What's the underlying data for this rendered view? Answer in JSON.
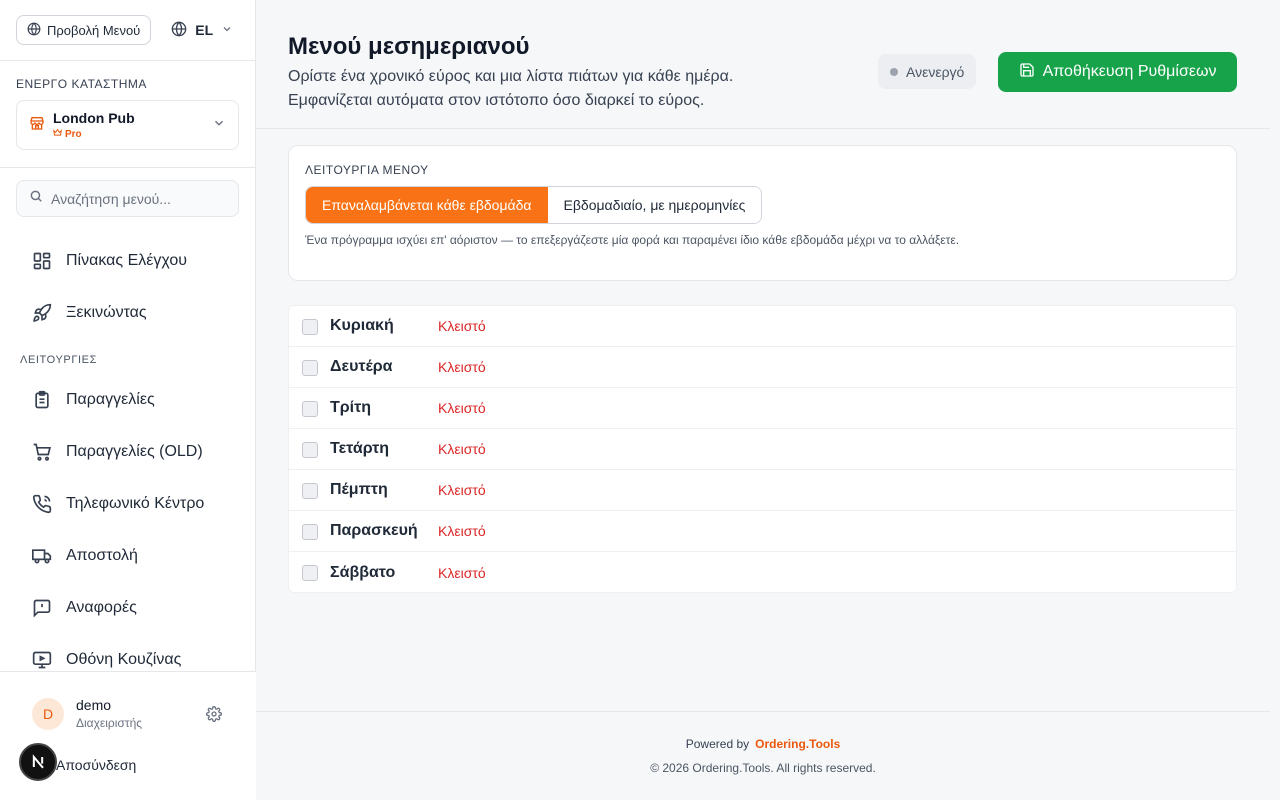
{
  "sidebar": {
    "view_menu_label": "Προβολή Μενού",
    "language_code": "EL",
    "active_store_label": "ΕΝΕΡΓΟ ΚΑΤΑΣΤΗΜΑ",
    "store_name": "London Pub",
    "store_plan": "Pro",
    "search_placeholder": "Αναζήτηση μενού...",
    "nav_top": [
      {
        "label": "Πίνακας Ελέγχου",
        "icon": "dashboard-icon"
      },
      {
        "label": "Ξεκινώντας",
        "icon": "rocket-icon"
      }
    ],
    "section_label": "ΛΕΙΤΟΥΡΓΙΕΣ",
    "nav_ops": [
      {
        "label": "Παραγγελίες",
        "icon": "clipboard-icon"
      },
      {
        "label": "Παραγγελίες (OLD)",
        "icon": "cart-icon"
      },
      {
        "label": "Τηλεφωνικό Κέντρο",
        "icon": "phone-icon"
      },
      {
        "label": "Αποστολή",
        "icon": "truck-icon"
      },
      {
        "label": "Αναφορές",
        "icon": "report-icon"
      },
      {
        "label": "Οθόνη Κουζίνας",
        "icon": "monitor-icon"
      }
    ],
    "user": {
      "initial": "D",
      "name": "demo",
      "role": "Διαχειριστής"
    },
    "logout_label": "Αποσύνδεση"
  },
  "header": {
    "title": "Μενού μεσημεριανού",
    "subtitle": "Ορίστε ένα χρονικό εύρος και μια λίστα πιάτων για κάθε ημέρα. Εμφανίζεται αυτόματα στον ιστότοπο όσο διαρκεί το εύρος.",
    "status": "Ανενεργό",
    "save_label": "Αποθήκευση Ρυθμίσεων"
  },
  "mode": {
    "label": "ΛΕΙΤΟΥΡΓΙΑ ΜΕΝΟΥ",
    "options": [
      "Επαναλαμβάνεται κάθε εβδομάδα",
      "Εβδομαδιαίο, με ημερομηνίες"
    ],
    "selected": "Επαναλαμβάνεται κάθε εβδομάδα",
    "help": "Ένα πρόγραμμα ισχύει επ' αόριστον — το επεξεργάζεστε μία φορά και παραμένει ίδιο κάθε εβδομάδα μέχρι να το αλλάξετε."
  },
  "days": [
    {
      "name": "Κυριακή",
      "status": "Κλειστό",
      "checked": false
    },
    {
      "name": "Δευτέρα",
      "status": "Κλειστό",
      "checked": false
    },
    {
      "name": "Τρίτη",
      "status": "Κλειστό",
      "checked": false
    },
    {
      "name": "Τετάρτη",
      "status": "Κλειστό",
      "checked": false
    },
    {
      "name": "Πέμπτη",
      "status": "Κλειστό",
      "checked": false
    },
    {
      "name": "Παρασκευή",
      "status": "Κλειστό",
      "checked": false
    },
    {
      "name": "Σάββατο",
      "status": "Κλειστό",
      "checked": false
    }
  ],
  "footer": {
    "powered_by": "Powered by",
    "brand": "Ordering.Tools",
    "copyright": "© 2026 Ordering.Tools. All rights reserved."
  },
  "colors": {
    "accent": "#f97316",
    "save": "#16a34a",
    "closed": "#dc2626"
  }
}
